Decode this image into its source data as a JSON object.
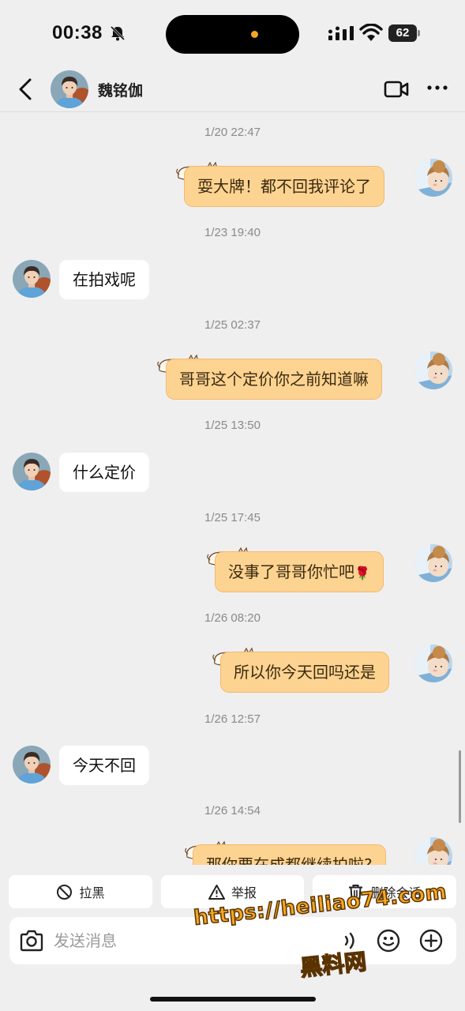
{
  "status_bar": {
    "time": "00:38",
    "battery": "62",
    "icons": [
      "bell-muted-icon",
      "signal-icon",
      "wifi-icon",
      "battery-icon"
    ]
  },
  "header": {
    "contact_name": "魏铭伽",
    "icons": [
      "back-arrow-icon",
      "video-call-icon",
      "more-icon"
    ]
  },
  "chat": {
    "messages": [
      {
        "timestamp": "1/20 22:47",
        "from": "me",
        "text": "耍大牌！都不回我评论了"
      },
      {
        "timestamp": "1/23 19:40",
        "from": "them",
        "text": "在拍戏呢"
      },
      {
        "timestamp": "1/25 02:37",
        "from": "me",
        "text": "哥哥这个定价你之前知道嘛"
      },
      {
        "timestamp": "1/25 13:50",
        "from": "them",
        "text": "什么定价"
      },
      {
        "timestamp": "1/25 17:45",
        "from": "me",
        "text": "没事了哥哥你忙吧",
        "emoji": "🌹"
      },
      {
        "timestamp": "1/26 08:20",
        "from": "me",
        "text": "所以你今天回吗还是"
      },
      {
        "timestamp": "1/26 12:57",
        "from": "them",
        "text": "今天不回"
      },
      {
        "timestamp": "1/26 14:54",
        "from": "me",
        "text": "那你要在成都继续拍啦?"
      }
    ]
  },
  "actions": {
    "block": "拉黑",
    "report": "举报",
    "delete": "删除会话"
  },
  "input": {
    "placeholder": "发送消息"
  },
  "watermark": {
    "url": "https://heiliao74.com",
    "name": "黑料网"
  },
  "colors": {
    "background": "#efeff0",
    "outgoing_bubble": "#fdd391",
    "incoming_bubble": "#ffffff",
    "watermark": "#f5a623"
  }
}
